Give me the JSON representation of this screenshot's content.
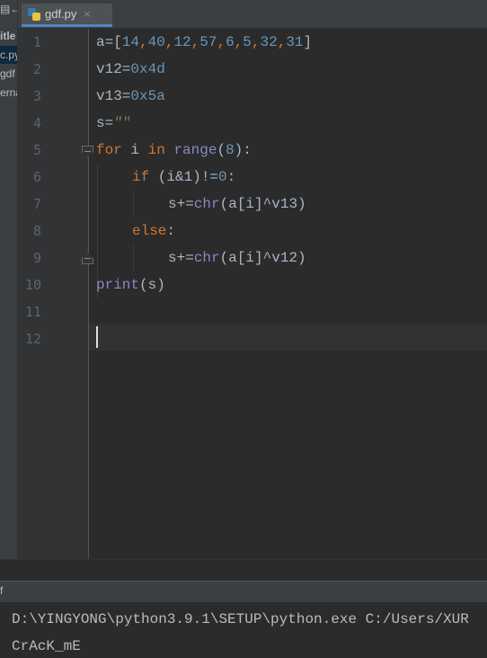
{
  "project_panel": {
    "items": [
      "▤←",
      "itle",
      "c.py",
      "gdf",
      "erna"
    ]
  },
  "tab": {
    "name": "gdf.py",
    "close": "×"
  },
  "line_numbers": [
    "1",
    "2",
    "3",
    "4",
    "5",
    "6",
    "7",
    "8",
    "9",
    "10",
    "11",
    "12"
  ],
  "code": {
    "l1": {
      "a": "a=[",
      "n1": "14",
      "c1": ",",
      "n2": "40",
      "c2": ",",
      "n3": "12",
      "c3": ",",
      "n4": "57",
      "c4": ",",
      "n5": "6",
      "c5": ",",
      "n6": "5",
      "c6": ",",
      "n7": "32",
      "c7": ",",
      "n8": "31",
      "e": "]"
    },
    "l2": {
      "a": "v12=",
      "n": "0x4d"
    },
    "l3": {
      "a": "v13=",
      "n": "0x5a"
    },
    "l4": {
      "a": "s=",
      "s": "\"\""
    },
    "l5": {
      "kw1": "for",
      "a": " i ",
      "kw2": "in",
      "sp": " ",
      "bi": "range",
      "p1": "(",
      "n": "8",
      "p2": "):"
    },
    "l6": {
      "kw": "if",
      "a": " (i&1)!=",
      "n": "0",
      "e": ":"
    },
    "l7": {
      "a": "s+=",
      "bi": "chr",
      "e": "(a[i]^v13)"
    },
    "l8": {
      "kw": "else",
      "e": ":"
    },
    "l9": {
      "a": "s+=",
      "bi": "chr",
      "e": "(a[i]^v12)"
    },
    "l10": {
      "bi": "print",
      "e": "(s)"
    }
  },
  "run_panel": {
    "tab_label": "f",
    "lines": [
      "D:\\YINGYONG\\python3.9.1\\SETUP\\python.exe C:/Users/XUR",
      "CrAcK_mE"
    ]
  }
}
